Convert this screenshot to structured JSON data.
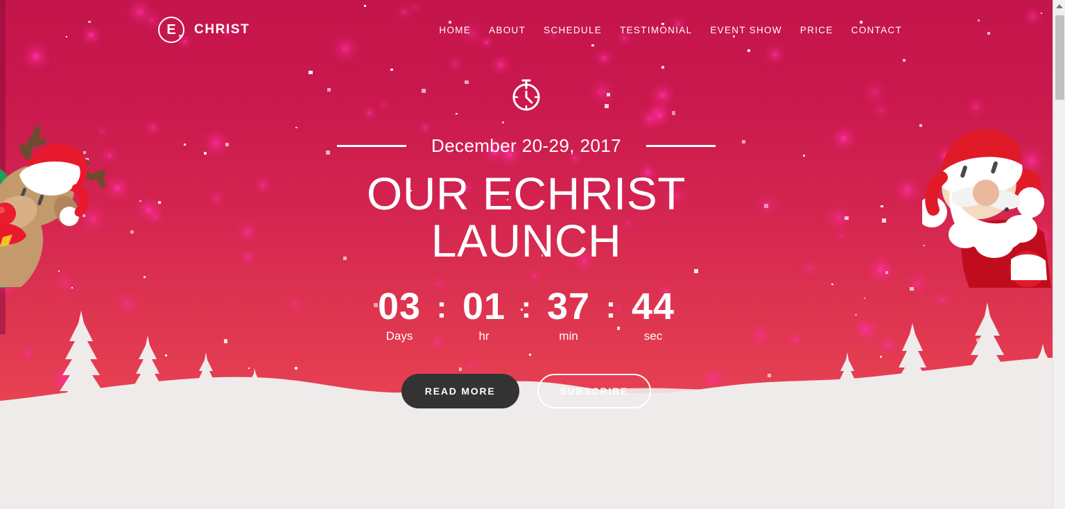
{
  "header": {
    "logo": {
      "mark": "E",
      "text": "CHRIST",
      "icon": "logo-circle-icon"
    },
    "nav": [
      {
        "label": "HOME"
      },
      {
        "label": "ABOUT"
      },
      {
        "label": "SCHEDULE"
      },
      {
        "label": "TESTIMONIAL"
      },
      {
        "label": "EVENT SHOW"
      },
      {
        "label": "PRICE"
      },
      {
        "label": "CONTACT"
      }
    ]
  },
  "hero": {
    "timer_icon": "stopwatch-icon",
    "date": "December 20-29, 2017",
    "title": "OUR ECHRIST LAUNCH",
    "countdown": {
      "separator": ":",
      "units": [
        {
          "value": "03",
          "label": "Days"
        },
        {
          "value": "01",
          "label": "hr"
        },
        {
          "value": "37",
          "label": "min"
        },
        {
          "value": "44",
          "label": "sec"
        }
      ]
    },
    "buttons": {
      "primary": "READ MORE",
      "outline": "SUBSCRIBE"
    }
  },
  "decor": {
    "reindeer": "reindeer-character",
    "santa": "santa-character",
    "trees": "pine-trees",
    "snow": "snow-ground"
  },
  "colors": {
    "bg_top": "#c4154c",
    "bg_bottom": "#e8424f",
    "accent_white": "#ffffff",
    "button_dark": "#333333",
    "snow": "#efebeb",
    "particle": "#ff2ea0"
  },
  "scrollbar": {
    "arrow": "scroll-up-arrow-icon"
  }
}
